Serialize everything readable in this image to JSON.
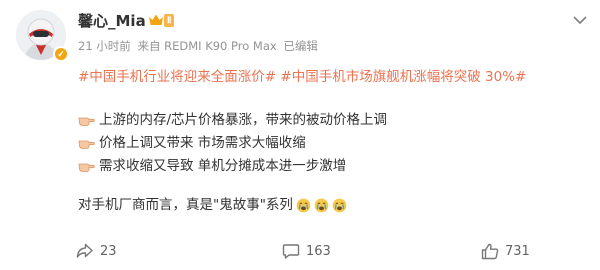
{
  "user": {
    "name": "馨心_Mia",
    "vip_level": "Ⅱ",
    "verified_badge": "✓"
  },
  "meta": {
    "time": "21 小时前",
    "source": "来自 REDMI K90 Pro Max",
    "edited": "已编辑"
  },
  "post": {
    "topics": [
      "#中国手机行业将迎来全面涨价#",
      "#中国手机市场旗舰机涨幅将突破 30%#"
    ],
    "points": [
      "上游的内存/芯片价格暴涨，带来的被动价格上调",
      "价格上调又带来 市场需求大幅收缩",
      "需求收缩又导致 单机分摊成本进一步激增"
    ],
    "point_icon": "pointing-hand-emoji",
    "closing": "对手机厂商而言，真是\"鬼故事\"系列",
    "closing_emojis": [
      "crying-face-emoji",
      "crying-face-emoji",
      "crying-face-emoji"
    ]
  },
  "actions": {
    "repost_count": "23",
    "comment_count": "163",
    "like_count": "731"
  },
  "colors": {
    "topic": "#eb7350",
    "meta": "#939393",
    "text": "#333333",
    "vip": "#f2a413"
  }
}
